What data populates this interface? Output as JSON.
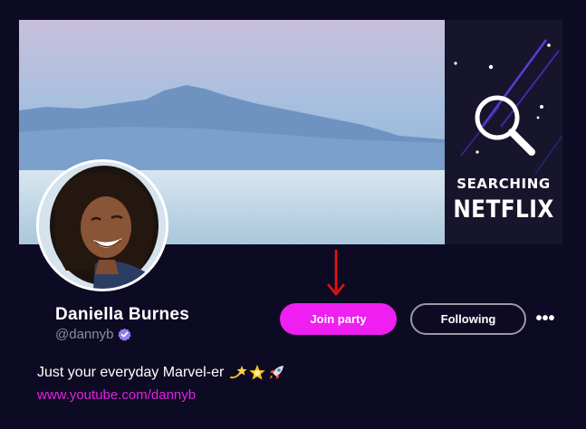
{
  "banner": {
    "side_line_1": "SEARCHING",
    "side_line_2": "NETFLIX",
    "side_icon": "magnifier-icon"
  },
  "profile": {
    "name": "Daniella Burnes",
    "handle": "@dannyb",
    "verified_icon": "verified-badge-icon",
    "bio": "Just your everyday Marvel-er",
    "bio_emojis": [
      "dizzy-star-icon",
      "glowing-star-icon",
      "rocket-icon"
    ],
    "link": "www.youtube.com/dannyb"
  },
  "actions": {
    "join_label": "Join party",
    "following_label": "Following",
    "more_label": "•••",
    "pointer_icon": "down-arrow-icon"
  },
  "colors": {
    "background": "#0d0b24",
    "accent": "#ee1ff0",
    "link": "#e41fe6",
    "muted": "#8d8aa3",
    "arrow": "#ee1111"
  }
}
